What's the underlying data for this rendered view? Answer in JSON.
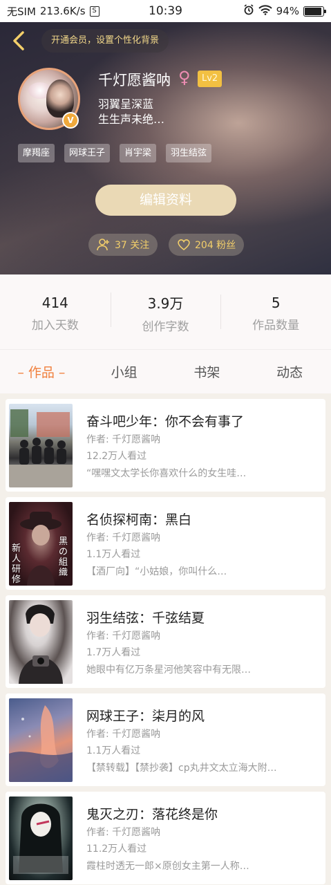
{
  "status_bar": {
    "carrier": "无SIM",
    "speed": "213.6K/s",
    "sim_icon": "S",
    "time": "10:39",
    "battery": "94%",
    "battery_level": 0.94
  },
  "header": {
    "vip_banner": "开通会员，设置个性化背景",
    "username": "千灯愿酱呐",
    "gender": "♀",
    "level": "Lv2",
    "verified_mark": "V",
    "bio_line1": "羽翼呈深蓝",
    "bio_line2": "生生声未绝…",
    "tags": [
      "摩羯座",
      "网球王子",
      "肖宇梁",
      "羽生结弦"
    ],
    "edit_button": "编辑资料",
    "following": "37 关注",
    "fans": "204 粉丝"
  },
  "stats": [
    {
      "value": "414",
      "label": "加入天数"
    },
    {
      "value": "3.9万",
      "label": "创作字数"
    },
    {
      "value": "5",
      "label": "作品数量"
    }
  ],
  "tabs": [
    "– 作品 –",
    "小组",
    "书架",
    "动态"
  ],
  "works": [
    {
      "title": "奋斗吧少年：你不会有事了",
      "author": "作者: 千灯愿酱呐",
      "views": "12.2万人看过",
      "summary": "“嘿嘿文太学长你喜欢什么的女生哇…"
    },
    {
      "title": "名侦探柯南：黑白",
      "author": "作者: 千灯愿酱呐",
      "views": "1.1万人看过",
      "summary": "【酒厂向】“小姑娘，你叫什么…"
    },
    {
      "title": "羽生结弦：千弦结夏",
      "author": "作者: 千灯愿酱呐",
      "views": "1.7万人看过",
      "summary": "她眼中有亿万条星河他笑容中有无限…"
    },
    {
      "title": "网球王子：柒月的风",
      "author": "作者: 千灯愿酱呐",
      "views": "1.1万人看过",
      "summary": "【禁转载】【禁抄袭】cp丸井文太立海大附…"
    },
    {
      "title": "鬼灭之刃：落花终是你",
      "author": "作者: 千灯愿酱呐",
      "views": "11.2万人看过",
      "summary": "霞柱时透无一郎×原创女主第一人称…"
    }
  ],
  "colors": {
    "accent": "#f07f3c",
    "gold": "#f3cf6a",
    "level": "#f2c042",
    "gender": "#ee8db3",
    "edit_button": "#ead9b5"
  },
  "icons": {
    "back": "chevron-left-icon",
    "following": "user-plus-icon",
    "fans": "heart-icon",
    "wifi": "wifi-icon",
    "alarm": "alarm-icon"
  },
  "cover_texts": {
    "cover2_left": "新人研修",
    "cover2_right": "黑の組織"
  }
}
